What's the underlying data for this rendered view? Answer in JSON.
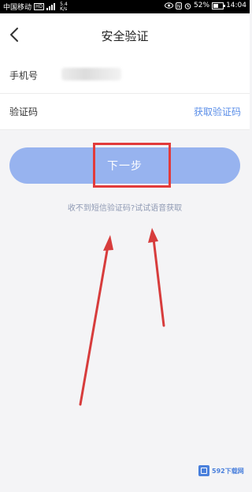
{
  "status_bar": {
    "carrier": "中国移动",
    "network_speed": "5.4\nK/s",
    "battery": "52%",
    "time": "14:04"
  },
  "header": {
    "title": "安全验证"
  },
  "form": {
    "phone_label": "手机号",
    "code_label": "验证码",
    "get_code_label": "获取验证码"
  },
  "actions": {
    "next_label": "下一步",
    "voice_hint": "收不到短信验证码?试试语音获取"
  },
  "watermark": {
    "text": "592下载网"
  },
  "colors": {
    "accent": "#5a8ee8",
    "button": "#97b3ef",
    "annotation": "#e23b3b"
  }
}
